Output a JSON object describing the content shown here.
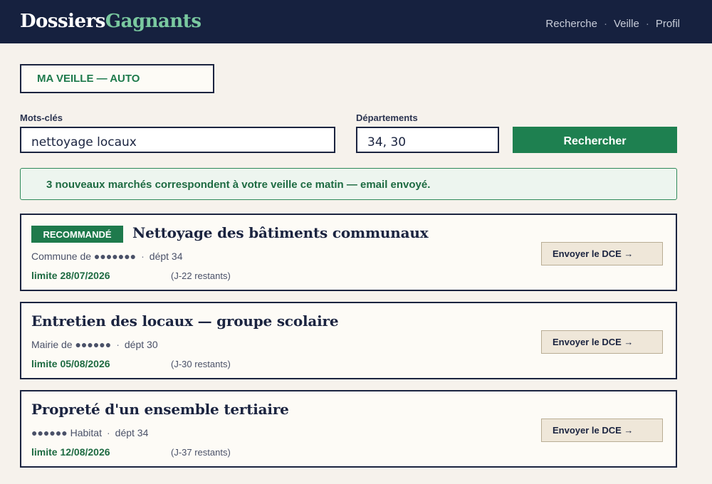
{
  "brand": {
    "part1": "Dossiers",
    "part2": "Gagnants"
  },
  "nav": {
    "items": [
      "Recherche",
      "Veille",
      "Profil"
    ],
    "separator": "·"
  },
  "veille": {
    "label": "MA VEILLE — AUTO"
  },
  "search": {
    "keywords_label": "Mots-clés",
    "keywords_value": "nettoyage locaux",
    "departments_label": "Départements",
    "departments_value": "34, 30",
    "button_label": "Rechercher"
  },
  "alert": {
    "icon": "check-icon",
    "glyph": "",
    "text": "3 nouveaux marchés correspondent à votre veille ce matin — email envoyé."
  },
  "results": [
    {
      "badge": "RECOMMANDÉ",
      "title": "Nettoyage des bâtiments communaux",
      "buyer": "Commune de ●●●●●●●",
      "dept": "dépt 34",
      "deadline": "limite 28/07/2026",
      "remaining": "(J-22 restants)",
      "action": "Envoyer le DCE →"
    },
    {
      "badge": "",
      "title": "Entretien des locaux — groupe scolaire",
      "buyer": "Mairie de ●●●●●●",
      "dept": "dépt 30",
      "deadline": "limite 05/08/2026",
      "remaining": "(J-30 restants)",
      "action": "Envoyer le DCE →"
    },
    {
      "badge": "",
      "title": "Propreté d'un ensemble tertiaire",
      "buyer": "●●●●●● Habitat",
      "dept": "dépt 34",
      "deadline": "limite 12/08/2026",
      "remaining": "(J-37 restants)",
      "action": "Envoyer le DCE →"
    }
  ],
  "colors": {
    "topbar": "#16213f",
    "accent_green": "#1e8050",
    "logo_green": "#7ac9a0",
    "background": "#f6f2ec"
  }
}
